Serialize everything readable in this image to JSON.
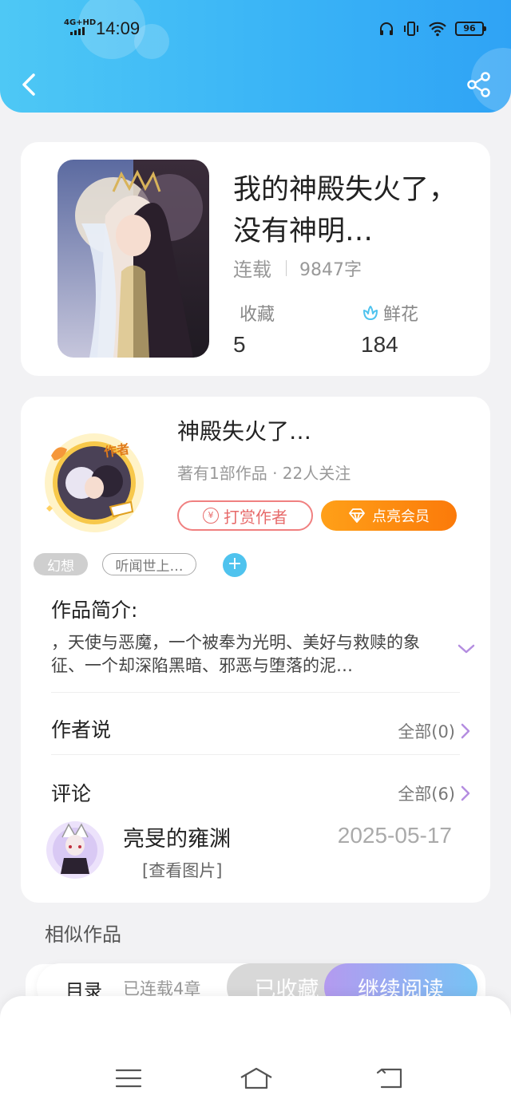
{
  "status_bar": {
    "network": "4G+HD",
    "time": "14:09",
    "battery": "96"
  },
  "book": {
    "title": "我的神殿失火了，没有神明…",
    "status": "连载",
    "word_count": "9847字",
    "favorites_label": "收藏",
    "favorites_count": "5",
    "flowers_label": "鲜花",
    "flowers_count": "184"
  },
  "author": {
    "badge": "作者",
    "name": "神殿失火了…",
    "meta": "著有1部作品 · 22人关注",
    "tip_label": "打赏作者",
    "tip_icon_text": "¥",
    "vip_label": "点亮会员"
  },
  "tags": [
    "幻想",
    "听闻世上…"
  ],
  "add_tag": "+",
  "intro": {
    "title": "作品简介:",
    "text": "，天使与恶魔，一个被奉为光明、美好与救赎的象征、一个却深陷黑暗、邪恶与堕落的泥…"
  },
  "author_says": {
    "title": "作者说",
    "see_all": "全部(0)"
  },
  "comments": {
    "title": "评论",
    "see_all": "全部(6)",
    "items": [
      {
        "user": "亮旻的雍渊",
        "date": "2025-05-17",
        "content": "[查看图片]"
      }
    ]
  },
  "similar_title": "相似作品",
  "action_bar": {
    "toc_label": "目录",
    "chapters": "已连载4章",
    "collected_label": "已收藏",
    "read_label": "继续阅读"
  },
  "icons": {
    "back": "back-arrow-icon",
    "share": "share-icon",
    "flower": "flower-icon",
    "diamond": "diamond-icon",
    "expand": "chevron-down-icon",
    "chevron": "chevron-right-icon",
    "menu": "menu-icon",
    "home": "home-icon",
    "nav_back": "back-icon"
  },
  "colors": {
    "header": "#3ab4f6",
    "tip": "#e76a6a",
    "vip": "#fb7a0a",
    "read_button": "#9ab0f2",
    "tag_add": "#4fc3ee",
    "expand": "#b48de0"
  }
}
